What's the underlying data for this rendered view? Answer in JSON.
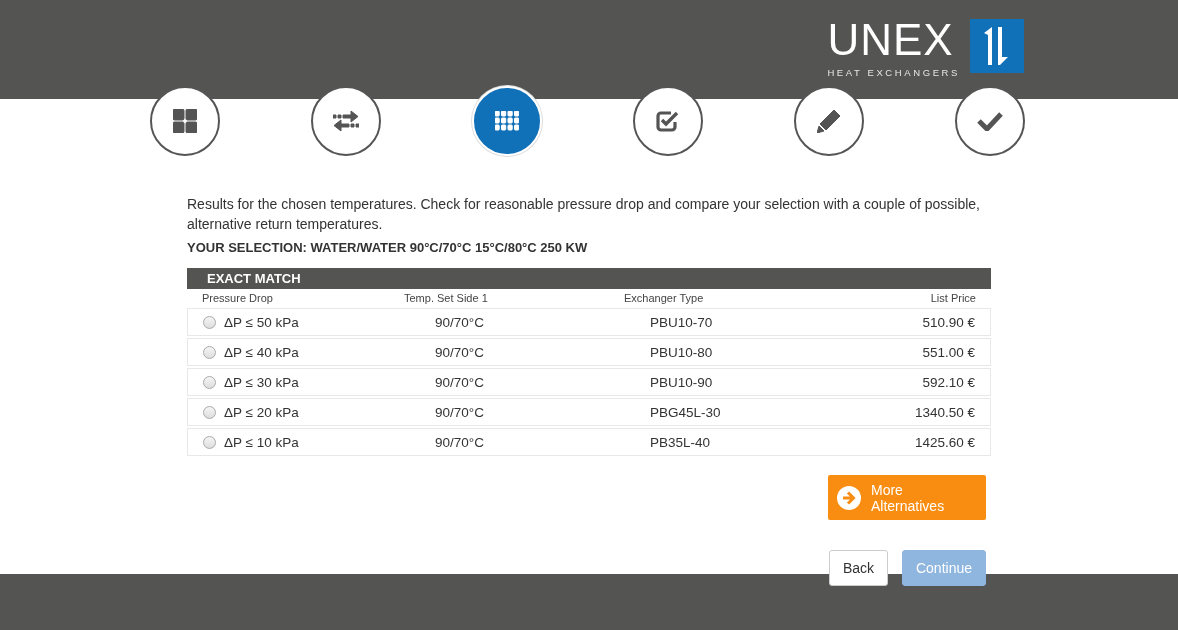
{
  "logo": {
    "wordmark": "UNEX",
    "tagline": "HEAT EXCHANGERS"
  },
  "steps": [
    {
      "kind": "tiles",
      "selected": false
    },
    {
      "kind": "swap",
      "selected": false
    },
    {
      "kind": "grid",
      "selected": true
    },
    {
      "kind": "checkbox",
      "selected": false
    },
    {
      "kind": "pencil",
      "selected": false
    },
    {
      "kind": "check",
      "selected": false
    }
  ],
  "intro": "Results for the chosen temperatures. Check for reasonable pressure drop and compare your selection with a couple of possible, alternative return temperatures.",
  "selection": "YOUR SELECTION: WATER/WATER 90°C/70°C 15°C/80°C 250 KW",
  "table": {
    "title": "EXACT MATCH",
    "columns": [
      "Pressure Drop",
      "Temp. Set Side 1",
      "Exchanger Type",
      "List Price"
    ],
    "rows": [
      {
        "pressure_drop": "ΔP ≤ 50 kPa",
        "temp_set": "90/70°C",
        "type": "PBU10-70",
        "price": "510.90 €",
        "selected": false
      },
      {
        "pressure_drop": "ΔP ≤ 40 kPa",
        "temp_set": "90/70°C",
        "type": "PBU10-80",
        "price": "551.00 €",
        "selected": false
      },
      {
        "pressure_drop": "ΔP ≤ 30 kPa",
        "temp_set": "90/70°C",
        "type": "PBU10-90",
        "price": "592.10 €",
        "selected": false
      },
      {
        "pressure_drop": "ΔP ≤ 20 kPa",
        "temp_set": "90/70°C",
        "type": "PBG45L-30",
        "price": "1340.50 €",
        "selected": false
      },
      {
        "pressure_drop": "ΔP ≤ 10 kPa",
        "temp_set": "90/70°C",
        "type": "PB35L-40",
        "price": "1425.60 €",
        "selected": false
      }
    ]
  },
  "more_button": {
    "label_line_1": "More",
    "label_line_2": "Alternatives"
  },
  "back_button": {
    "label": "Back",
    "disabled": false
  },
  "continue_button": {
    "label": "Continue",
    "disabled": true
  }
}
